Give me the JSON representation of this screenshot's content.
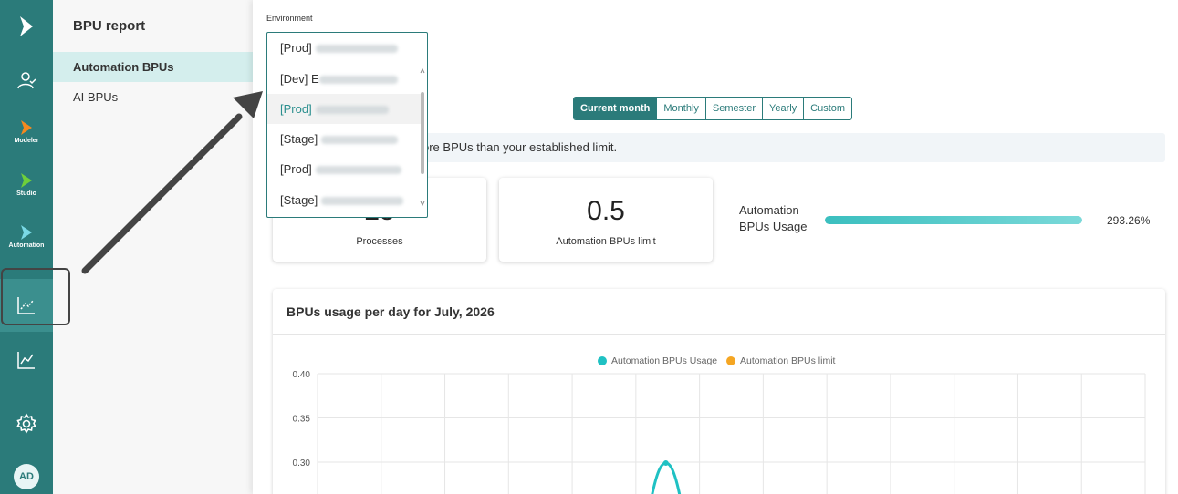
{
  "rail": {
    "items": [
      {
        "name": "brand-logo",
        "label": ""
      },
      {
        "name": "users",
        "label": ""
      },
      {
        "name": "modeler",
        "label": "Modeler"
      },
      {
        "name": "studio",
        "label": "Studio"
      },
      {
        "name": "automation",
        "label": "Automation"
      },
      {
        "name": "bpu-report",
        "label": ""
      },
      {
        "name": "analytics",
        "label": ""
      },
      {
        "name": "settings",
        "label": ""
      }
    ],
    "avatar": "AD"
  },
  "subnav": {
    "title": "BPU report",
    "items": [
      "Automation BPUs",
      "AI BPUs"
    ]
  },
  "environment": {
    "label": "Environment",
    "options": [
      "[Prod]",
      "[Dev] E",
      "[Prod]",
      "[Stage]",
      "[Prod]",
      "[Stage]"
    ]
  },
  "period_tabs": [
    "Current month",
    "Monthly",
    "Semester",
    "Yearly",
    "Custom"
  ],
  "banner": {
    "text": "ore BPUs than your established limit."
  },
  "cards": [
    {
      "value": "25",
      "label": "Processes"
    },
    {
      "value": "0.5",
      "label": "Automation BPUs limit"
    }
  ],
  "usage": {
    "label": "Automation BPUs Usage",
    "percent_text": "293.26%",
    "fill_fraction": 1.0
  },
  "colors": {
    "primary": "#2b7b7a",
    "usage_line": "#1fc1c3",
    "limit_line": "#f5a623"
  },
  "chart_data": {
    "type": "line",
    "title": "BPUs usage per day for July, 2026",
    "legend": [
      "Automation BPUs Usage",
      "Automation BPUs limit"
    ],
    "legend_placement": "top-center",
    "y_ticks": [
      "0.40",
      "0.35",
      "0.30"
    ],
    "ylim": [
      0.25,
      0.4
    ],
    "grid": true,
    "series": [
      {
        "name": "Automation BPUs Usage",
        "points": [
          {
            "day_index": 5.5,
            "y": 0.299
          }
        ]
      }
    ]
  }
}
